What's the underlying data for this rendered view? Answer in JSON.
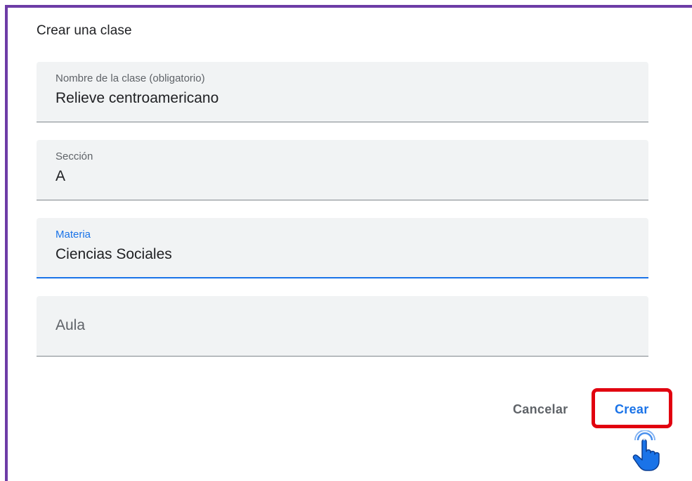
{
  "dialog": {
    "title": "Crear una clase"
  },
  "fields": {
    "class_name": {
      "label": "Nombre de la clase (obligatorio)",
      "value": "Relieve centroamericano"
    },
    "section": {
      "label": "Sección",
      "value": "A"
    },
    "subject": {
      "label": "Materia",
      "value": "Ciencias Sociales",
      "focused": true
    },
    "room": {
      "placeholder": "Aula",
      "value": ""
    }
  },
  "actions": {
    "cancel_label": "Cancelar",
    "create_label": "Crear"
  },
  "icons": {
    "pointer": "hand-pointer-icon"
  },
  "colors": {
    "accent": "#1a73e8",
    "highlight": "#e1000f",
    "frame": "#6d3ca6"
  }
}
